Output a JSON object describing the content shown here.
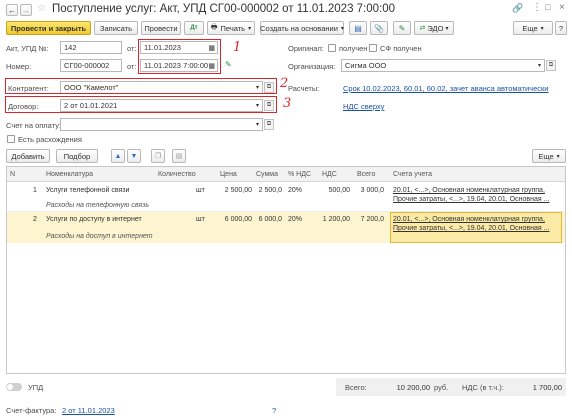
{
  "window": {
    "title": "Поступление услуг: Акт, УПД СГ00-000002 от 11.01.2023 7:00:00"
  },
  "toolbar": {
    "post_close": "Провести и закрыть",
    "write": "Записать",
    "post": "Провести",
    "print": "Печать",
    "create_basis": "Создать на основании",
    "edo": "ЭДО",
    "more": "Еще",
    "help": "?"
  },
  "header": {
    "doc_label": "Акт, УПД №:",
    "doc_number": "142",
    "from1": "от:",
    "doc_date": "11.01.2023",
    "number_label": "Номер:",
    "number": "СГ00-000002",
    "from2": "от:",
    "datetime": "11.01.2023  7:00:00",
    "original_label": "Оригинал:",
    "received_label": "получен",
    "sf_received_label": "СФ получен",
    "org_label": "Организация:",
    "org": "Сигма ООО",
    "contractor_label": "Контрагент:",
    "contractor": "ООО \"Камелот\"",
    "settlements_label": "Расчеты:",
    "settlements": "Срок 10.02.2023, 60.01, 60.02, зачет аванса автоматически",
    "contract_label": "Договор:",
    "contract": "2 от 01.01.2021",
    "vat_link": "НДС сверху",
    "invoice_label": "Счет на оплату:",
    "invoice": "",
    "discrepancy_label": "Есть расхождения"
  },
  "annotations": [
    "1",
    "2",
    "3"
  ],
  "table_toolbar": {
    "add": "Добавить",
    "select": "Подбор",
    "more": "Еще"
  },
  "table": {
    "columns": [
      "N",
      "Номенклатура",
      "Количество",
      "Цена",
      "Сумма",
      "% НДС",
      "НДС",
      "Всего",
      "Счета учета"
    ],
    "rows": [
      {
        "n": "1",
        "item": "Услуги телефонной связи",
        "content": "Расходы на телефонную связь",
        "unit": "шт",
        "price": "2 500,00",
        "sum": "2 500,0",
        "vat_rate": "20%",
        "vat": "500,00",
        "total": "3 000,0",
        "account1": "20.01, <...>, Основная номенклатурная группа,",
        "account2": "Прочие затраты, <...>, 19.04, 20.01, Основная ..."
      },
      {
        "n": "2",
        "item": "Услуги по доступу в интернет",
        "content": "Расходы на доступ в интернет",
        "unit": "шт",
        "price": "6 000,00",
        "sum": "6 000,0",
        "vat_rate": "20%",
        "vat": "1 200,00",
        "total": "7 200,0",
        "account1": "20.01, <...>, Основная номенклатурная группа,",
        "account2": "Прочие затраты, <...>, 19.04, 20.01, Основная ..."
      }
    ]
  },
  "footer": {
    "upd_label": "УПД",
    "total_label": "Всего:",
    "total_value": "10 200,00",
    "currency": "руб.",
    "vat_label": "НДС (в т.ч.):",
    "vat_value": "1 700,00",
    "invoice_label": "Счет-фактура:",
    "invoice_link": "2 от 11.01.2023",
    "help": "?"
  },
  "colors": {
    "accent_yellow": "#f1c92c",
    "selected_row": "#fdf4d0",
    "link": "#1a52a6",
    "annotation_red": "#d9262c"
  }
}
